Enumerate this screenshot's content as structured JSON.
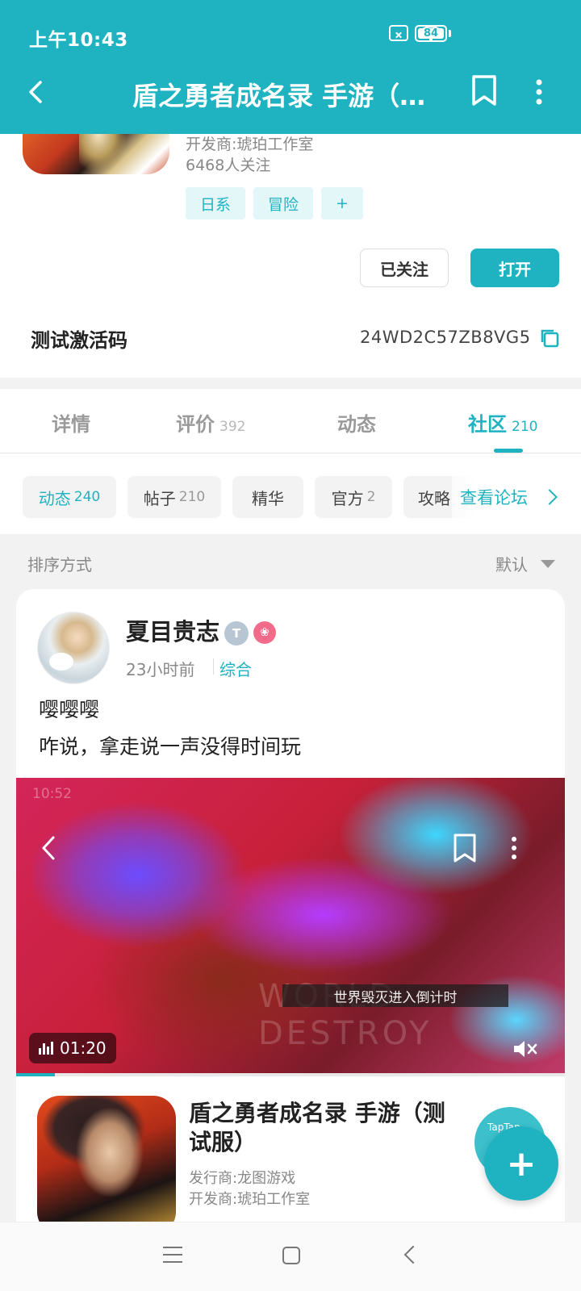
{
  "status_bar": {
    "time": "上午10:43",
    "battery": "84"
  },
  "nav": {
    "title": "盾之勇者成名录 手游（…"
  },
  "game": {
    "developer": "开发商:琥珀工作室",
    "followers": "6468人关注",
    "tags": [
      "日系",
      "冒险",
      "+"
    ],
    "followed_label": "已关注",
    "open_label": "打开",
    "code_label": "测试激活码",
    "code_value": "24WD2C57ZB8VG5"
  },
  "tabs": [
    {
      "label": "详情",
      "count": ""
    },
    {
      "label": "评价",
      "count": "392"
    },
    {
      "label": "动态",
      "count": ""
    },
    {
      "label": "社区",
      "count": "210"
    }
  ],
  "subfilters": [
    {
      "label": "动态",
      "count": "240"
    },
    {
      "label": "帖子",
      "count": "210"
    },
    {
      "label": "精华",
      "count": ""
    },
    {
      "label": "官方",
      "count": "2"
    },
    {
      "label": "攻略",
      "count": ""
    }
  ],
  "forum_link": "查看论坛",
  "sort": {
    "label": "排序方式",
    "value": "默认"
  },
  "post": {
    "username": "夏目贵志",
    "badge": "T",
    "time": "23小时前",
    "category": "综合",
    "line1": "嘤嘤嘤",
    "line2": "咋说，拿走说一声没得时间玩",
    "video": {
      "status_time": "10:52",
      "caption": "世界毁灭进入倒计时",
      "watermark": "WORLD DESTROY",
      "duration": "01:20",
      "progress": 0.07
    },
    "linked_game": {
      "title": "盾之勇者成名录 手游（测试服）",
      "publisher": "发行商:龙图游戏",
      "developer": "开发商:琥珀工作室"
    }
  },
  "fab": {
    "label": "+",
    "behind_label": "TapTap"
  },
  "colors": {
    "accent": "#1fb3c1"
  }
}
